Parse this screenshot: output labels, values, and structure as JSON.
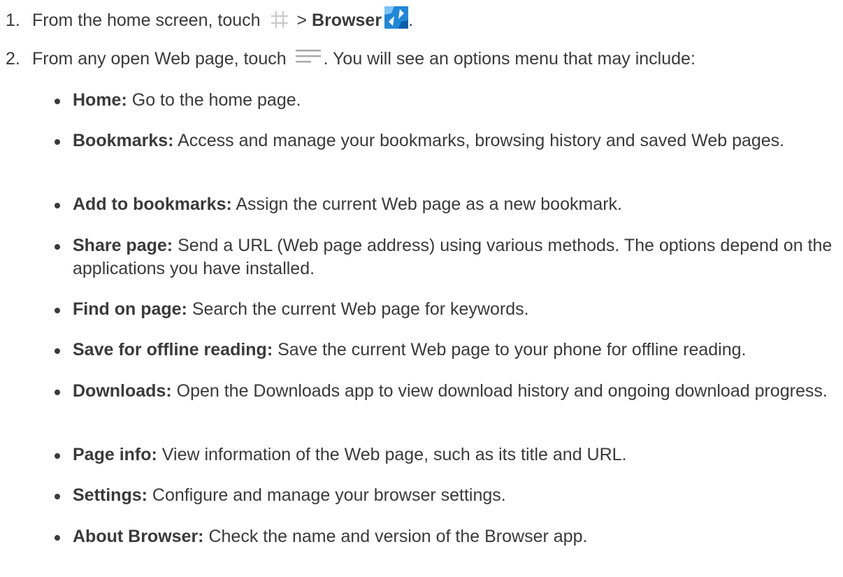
{
  "steps": [
    {
      "number": "1.",
      "prefix": "From the home screen, touch",
      "separator": ">",
      "bold": "Browser",
      "suffix": ".",
      "icons": [
        "apps-grid-icon",
        "browser-app-icon"
      ]
    },
    {
      "number": "2.",
      "prefix": "From any open Web page, touch",
      "suffix": ". You will see an options menu that may include:",
      "icons": [
        "menu-icon"
      ]
    }
  ],
  "options": [
    {
      "name": "Home:",
      "desc": "Go to the home page."
    },
    {
      "name": "Bookmarks:",
      "desc": "Access and manage your bookmarks, browsing history and saved Web pages."
    },
    {
      "name": "Add to bookmarks:",
      "desc": "Assign the current Web page as a new bookmark."
    },
    {
      "name": "Share page:",
      "desc": "Send a URL (Web page address) using various methods. The options depend on the applications you have installed."
    },
    {
      "name": "Find on page:",
      "desc": "Search the current Web page for keywords."
    },
    {
      "name": "Save for offline reading:",
      "desc": "Save the current Web page to your phone for offline reading."
    },
    {
      "name": "Downloads:",
      "desc": "Open the Downloads app to view download history and ongoing download progress."
    },
    {
      "name": "Page info:",
      "desc": "View information of the Web page, such as its title and URL."
    },
    {
      "name": "Settings:",
      "desc": "Configure and manage your browser settings."
    },
    {
      "name": "About Browser:",
      "desc": "Check the name and version of the Browser app."
    }
  ],
  "colors": {
    "text": "#3a3a3a",
    "grid_icon": "#c8c8c8",
    "browser_icon_blue": "#1e88d8",
    "menu_icon": "#a8a8a8"
  }
}
